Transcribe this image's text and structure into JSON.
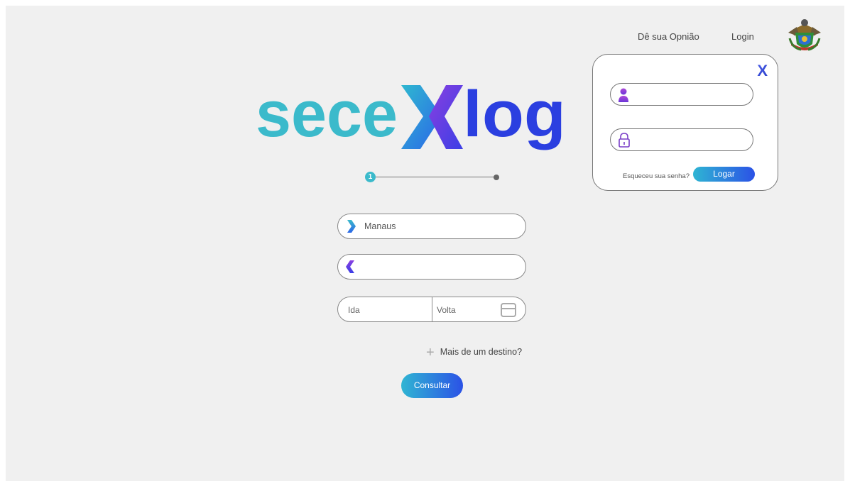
{
  "nav": {
    "opinion": "Dê sua Opnião",
    "login": "Login"
  },
  "logo": {
    "left": "sece",
    "right": "log"
  },
  "login_panel": {
    "close": "X",
    "forgot_password": "Esqueceu sua senha?",
    "submit": "Logar"
  },
  "stepper": {
    "current_step": "1"
  },
  "search": {
    "origin_value": "Manaus",
    "destination_value": "",
    "departure_placeholder": "Ida",
    "return_placeholder": "Volta",
    "more_destinations": "Mais de um destino?",
    "submit": "Consultar"
  },
  "icons": {
    "crest": "state-coat-of-arms-icon",
    "user": "user-icon",
    "lock": "lock-icon",
    "origin": "chevron-right-icon",
    "destination": "chevron-left-icon",
    "calendar": "calendar-icon",
    "plus": "plus-icon"
  },
  "colors": {
    "teal": "#3bbacb",
    "blue": "#2b52e6",
    "purple": "#8e44d8"
  }
}
